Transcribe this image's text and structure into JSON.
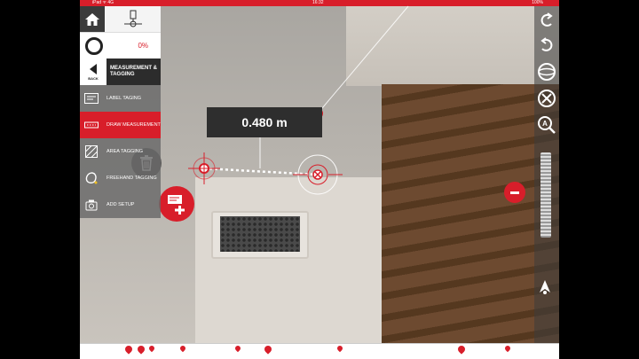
{
  "status_bar": {
    "carrier": "iPad ᯤ 4G",
    "time": "16:32",
    "battery": "100%"
  },
  "left_panel": {
    "home_label": "home",
    "progress_percent": "0%",
    "progress_value": 0,
    "back_label": "BACK",
    "mode_title": "MEASUREMENT & TAGGING",
    "menu_items": [
      {
        "label": "LABEL TAGING",
        "icon": "label-tag-icon",
        "active": false
      },
      {
        "label": "DRAW MEASUREMENT",
        "icon": "draw-measurement-icon",
        "active": true
      },
      {
        "label": "AREA TAGGING",
        "icon": "area-tag-icon",
        "active": false
      },
      {
        "label": "FREEHAND TAGGING",
        "icon": "freehand-tag-icon",
        "active": false
      },
      {
        "label": "ADD SETUP",
        "icon": "camera-setup-icon",
        "active": false
      }
    ]
  },
  "measurement": {
    "distance_label": "0.480 m"
  },
  "right_toolbar": {
    "icons": [
      "undo-icon",
      "redo-icon",
      "globe-icon",
      "cancel-icon",
      "zoom-icon"
    ]
  },
  "colors": {
    "accent": "#d81e2a",
    "panel_dark": "#2c2c2c",
    "menu_bg": "#6a6a6a"
  }
}
